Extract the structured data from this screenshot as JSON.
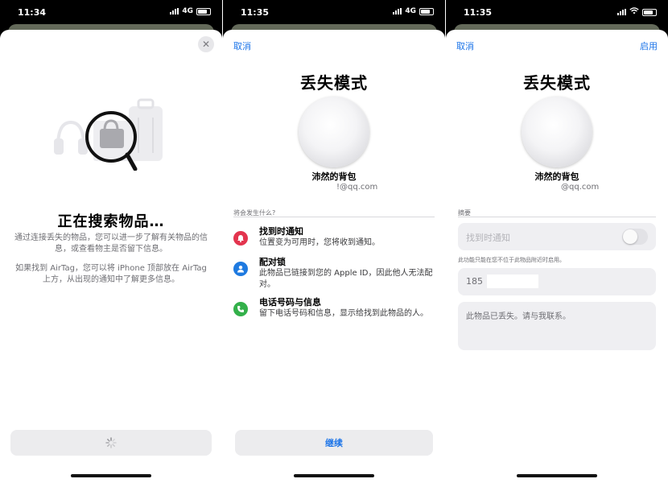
{
  "screens": [
    {
      "status": {
        "time": "11:34",
        "network": "4G"
      },
      "title": "正在搜索物品…",
      "desc1": "通过连接丢失的物品，您可以进一步了解有关物品的信息，或查看物主是否留下信息。",
      "desc2": "如果找到 AirTag，您可以将 iPhone 顶部放在 AirTag 上方，从出现的通知中了解更多信息。",
      "close_icon": "close-icon",
      "footer_icon": "spinner-icon"
    },
    {
      "status": {
        "time": "11:35",
        "network": "4G"
      },
      "cancel": "取消",
      "title": "丢失模式",
      "item_name": "沛然的背包",
      "email": "!@qq.com",
      "section_label": "将会发生什么?",
      "features": [
        {
          "title": "找到时通知",
          "desc": "位置变为可用时，您将收到通知。",
          "icon": "bell-icon",
          "color": "#e3344e"
        },
        {
          "title": "配对锁",
          "desc": "此物品已链接到您的 Apple ID，因此他人无法配对。",
          "icon": "person-icon",
          "color": "#1e7ae0"
        },
        {
          "title": "电话号码与信息",
          "desc": "留下电话号码和信息，显示给找到此物品的人。",
          "icon": "phone-icon",
          "color": "#33b04a"
        }
      ],
      "continue": "继续"
    },
    {
      "status": {
        "time": "11:35",
        "network": "wifi"
      },
      "cancel": "取消",
      "enable": "启用",
      "title": "丢失模式",
      "item_name": "沛然的背包",
      "email": "@qq.com",
      "section_label": "摘要",
      "notify_label": "找到时通知",
      "notify_toggle": false,
      "note": "此功能只能在您不位于此物品附近时启用。",
      "phone_prefix": "185",
      "message": "此物品已丢失。请与我联系。"
    }
  ]
}
